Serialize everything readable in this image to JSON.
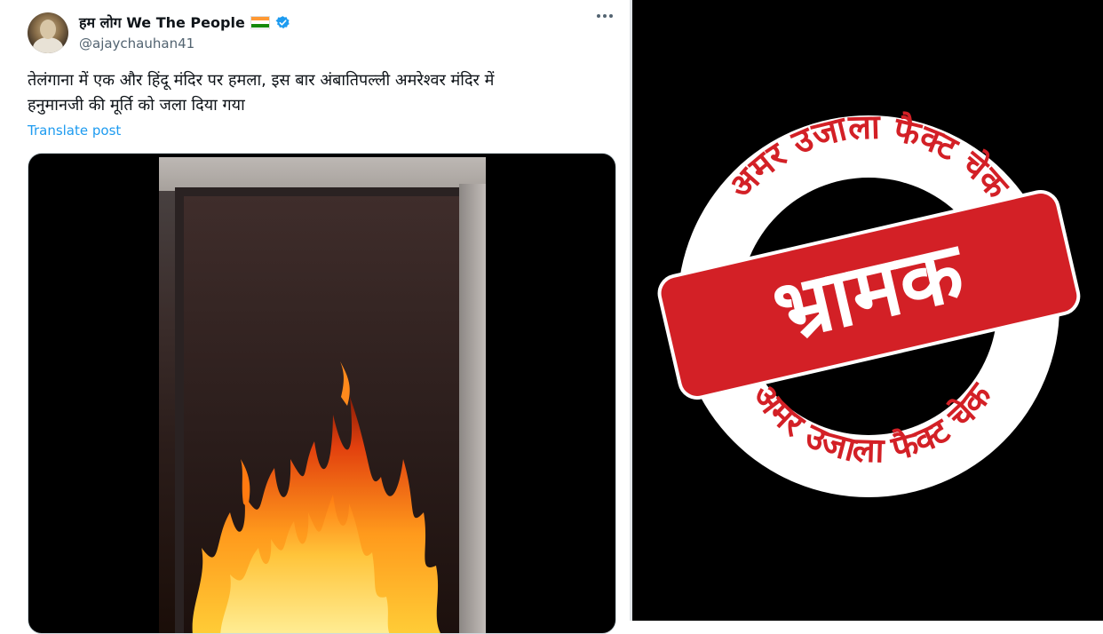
{
  "tweet": {
    "display_name": "हम लोग We The People",
    "handle": "@ajaychauhan41",
    "text_line1": "तेलंगाना में एक और हिंदू मंदिर पर हमला, इस बार अंबातिपल्ली अमरेश्वर मंदिर में",
    "text_line2": "हनुमानजी की मूर्ति को जला दिया गया",
    "translate_label": "Translate post",
    "flag_icon": "india-flag-icon",
    "verified_icon": "verified-badge-icon",
    "more_icon": "more-options-icon"
  },
  "stamp": {
    "top_arc_text": "अमर उजाला फैक्ट चेक",
    "bottom_arc_text": "अमर उजाला फैक्ट चेक",
    "verdict": "भ्रामक",
    "banner_color": "#d32026",
    "ring_color": "#ffffff",
    "background": "#000000"
  }
}
